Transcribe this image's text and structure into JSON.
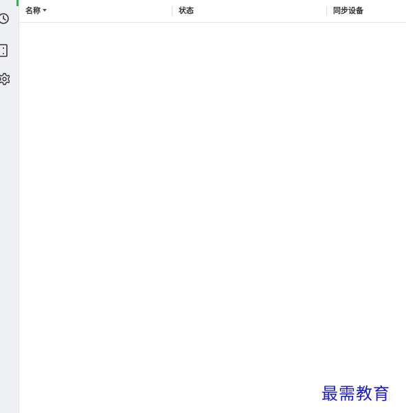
{
  "table_header": {
    "name_label": "名称",
    "status_label": "状态",
    "sync_device_label": "同步设备"
  },
  "sidebar": {
    "items": [
      {
        "icon": "clock-icon"
      },
      {
        "icon": "device-icon"
      },
      {
        "icon": "gear-icon"
      }
    ],
    "accent_color": "#2fb44a"
  },
  "watermark": {
    "text": "最需教育",
    "color": "#1a1ad6"
  }
}
